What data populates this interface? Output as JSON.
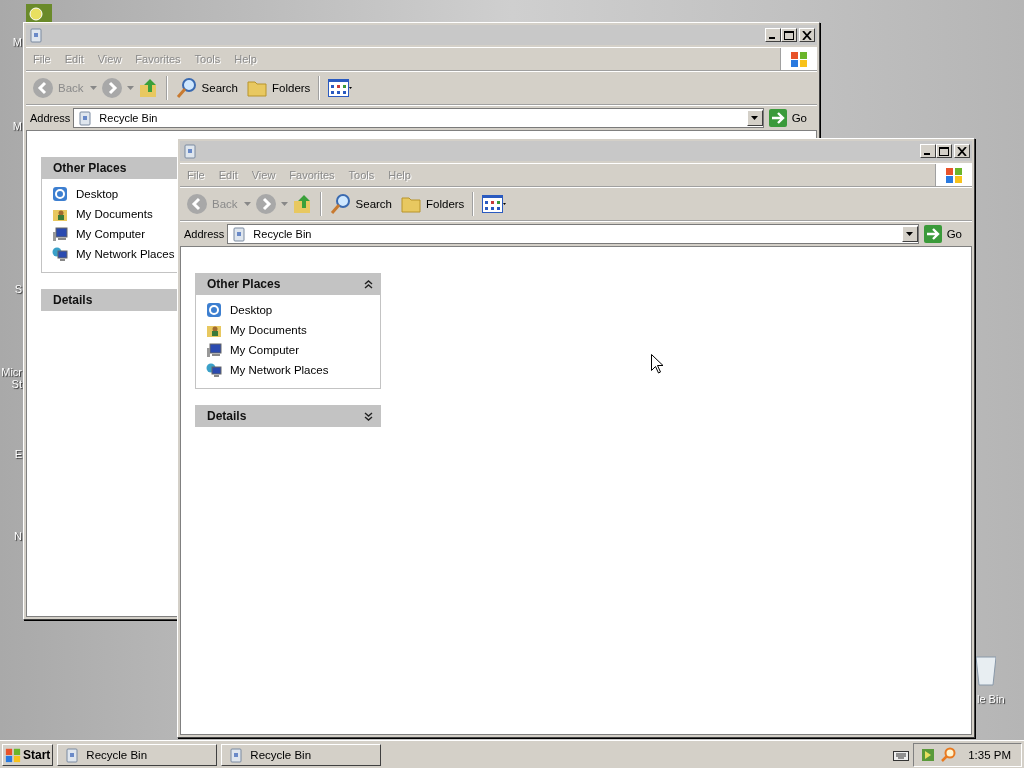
{
  "desktop": {
    "icon_labels": [
      "M",
      "M",
      "S",
      "Micr",
      "St",
      "E",
      "N"
    ],
    "right_icon_label": "le Bin"
  },
  "windows": [
    {
      "menu": [
        {
          "label": "File",
          "disabled": true
        },
        {
          "label": "Edit",
          "disabled": true
        },
        {
          "label": "View",
          "disabled": true
        },
        {
          "label": "Favorites",
          "disabled": true
        },
        {
          "label": "Tools",
          "disabled": true
        },
        {
          "label": "Help",
          "disabled": true
        }
      ],
      "toolbar": {
        "back": {
          "label": "Back",
          "disabled": true
        },
        "search": "Search",
        "folders": "Folders"
      },
      "address": {
        "label": "Address",
        "value": "Recycle Bin",
        "go": "Go"
      },
      "panels": [
        {
          "title": "Other Places",
          "items": [
            "Desktop",
            "My Documents",
            "My Computer",
            "My Network Places"
          ]
        },
        {
          "title": "Details"
        }
      ]
    },
    {
      "menu": [
        {
          "label": "File",
          "disabled": true
        },
        {
          "label": "Edit",
          "disabled": true
        },
        {
          "label": "View",
          "disabled": true
        },
        {
          "label": "Favorites",
          "disabled": true
        },
        {
          "label": "Tools",
          "disabled": true
        },
        {
          "label": "Help",
          "disabled": true
        }
      ],
      "toolbar": {
        "back": {
          "label": "Back",
          "disabled": true
        },
        "search": "Search",
        "folders": "Folders"
      },
      "address": {
        "label": "Address",
        "value": "Recycle Bin",
        "go": "Go"
      },
      "panels": [
        {
          "title": "Other Places",
          "expanded": true,
          "items": [
            "Desktop",
            "My Documents",
            "My Computer",
            "My Network Places"
          ]
        },
        {
          "title": "Details",
          "expanded": false
        }
      ]
    }
  ],
  "taskbar": {
    "start": "Start",
    "tasks": [
      {
        "label": "Recycle Bin",
        "selected": false
      },
      {
        "label": "Recycle Bin",
        "selected": false
      }
    ],
    "clock": "1:35 PM"
  }
}
